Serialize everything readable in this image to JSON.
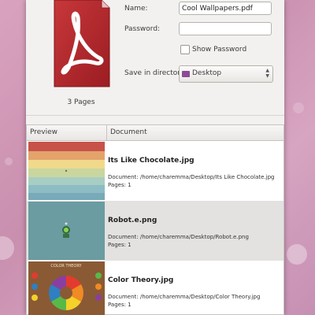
{
  "dialog": {
    "pages_label": "3 Pages",
    "name_label": "Name:",
    "name_value": "Cool Wallpapers.pdf",
    "password_label": "Password:",
    "password_value": "",
    "show_password_label": "Show Password",
    "show_password_checked": false,
    "save_dir_label": "Save in directory:",
    "save_dir_value": "Desktop"
  },
  "table": {
    "columns": [
      "Preview",
      "Document"
    ],
    "rows": [
      {
        "name": "Its Like Chocolate.jpg",
        "path": "Document: /home/charemma/Desktop/Its Like Chocolate.jpg",
        "pages": "Pages: 1",
        "selected": false
      },
      {
        "name": "Robot.e.png",
        "path": "Document: /home/charemma/Desktop/Robot.e.png",
        "pages": "Pages: 1",
        "selected": true
      },
      {
        "name": "Color Theory.jpg",
        "path": "Document: /home/charemma/Desktop/Color Theory.jpg",
        "pages": "Pages: 1",
        "selected": false
      }
    ]
  },
  "thumb_texts": {
    "color_theory_title": "COLOR THEORY"
  },
  "colors": {
    "pdf_red": "#b5262b",
    "folder": "#8a4b93",
    "selected_row": "#e3e2e0"
  }
}
